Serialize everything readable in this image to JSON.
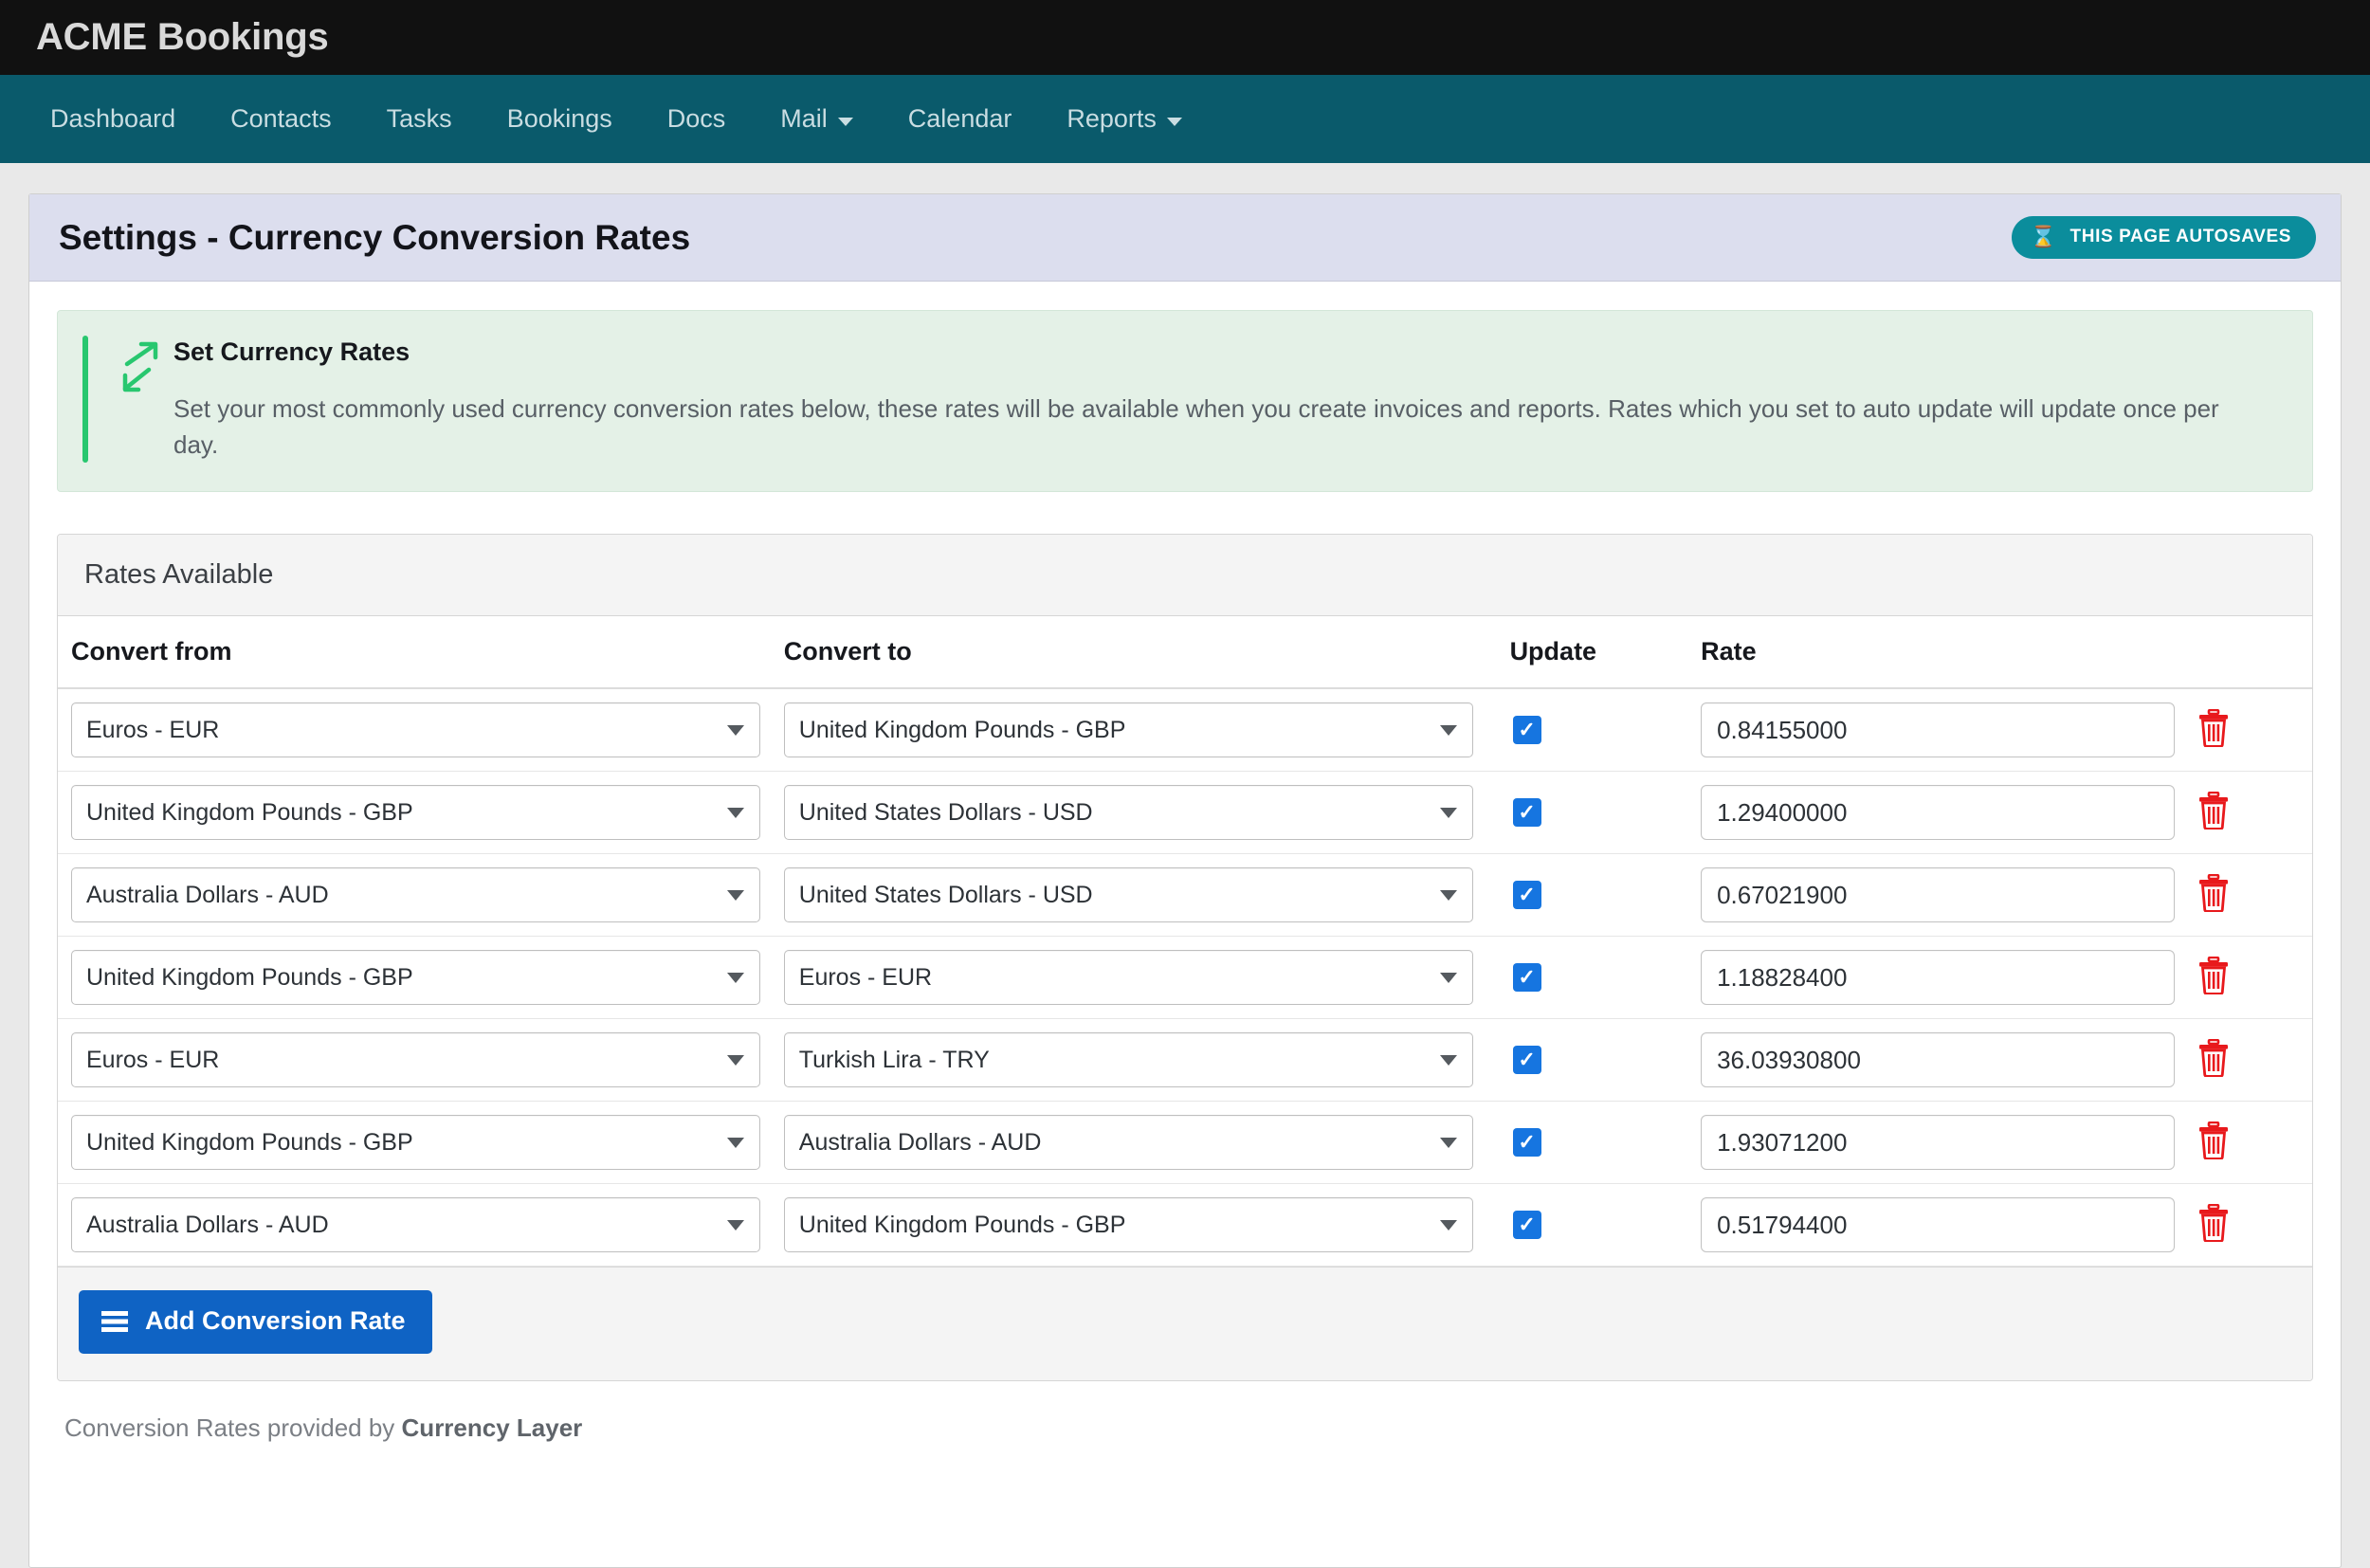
{
  "brand": {
    "title": "ACME Bookings"
  },
  "nav": {
    "items": [
      {
        "label": "Dashboard",
        "has_caret": false
      },
      {
        "label": "Contacts",
        "has_caret": false
      },
      {
        "label": "Tasks",
        "has_caret": false
      },
      {
        "label": "Bookings",
        "has_caret": false
      },
      {
        "label": "Docs",
        "has_caret": false
      },
      {
        "label": "Mail",
        "has_caret": true
      },
      {
        "label": "Calendar",
        "has_caret": false
      },
      {
        "label": "Reports",
        "has_caret": true
      }
    ]
  },
  "page": {
    "title": "Settings - Currency Conversion Rates",
    "autosave_badge": "THIS PAGE AUTOSAVES",
    "autosave_icon": "hourglass-icon"
  },
  "callout": {
    "icon": "expand-diagonal-arrows-icon",
    "title": "Set Currency Rates",
    "description": "Set your most commonly used currency conversion rates below, these rates will be available when you create invoices and reports. Rates which you set to auto update will update once per day."
  },
  "panel": {
    "heading": "Rates Available",
    "columns": {
      "from": "Convert from",
      "to": "Convert to",
      "update": "Update",
      "rate": "Rate",
      "delete": ""
    },
    "rows": [
      {
        "from": "Euros - EUR",
        "to": "United Kingdom Pounds - GBP",
        "update": true,
        "rate": "0.84155000",
        "delete_icon": "trash-icon"
      },
      {
        "from": "United Kingdom Pounds - GBP",
        "to": "United States Dollars - USD",
        "update": true,
        "rate": "1.29400000",
        "delete_icon": "trash-icon"
      },
      {
        "from": "Australia Dollars - AUD",
        "to": "United States Dollars - USD",
        "update": true,
        "rate": "0.67021900",
        "delete_icon": "trash-icon"
      },
      {
        "from": "United Kingdom Pounds - GBP",
        "to": "Euros - EUR",
        "update": true,
        "rate": "1.18828400",
        "delete_icon": "trash-icon"
      },
      {
        "from": "Euros - EUR",
        "to": "Turkish Lira - TRY",
        "update": true,
        "rate": "36.03930800",
        "delete_icon": "trash-icon"
      },
      {
        "from": "United Kingdom Pounds - GBP",
        "to": "Australia Dollars - AUD",
        "update": true,
        "rate": "1.93071200",
        "delete_icon": "trash-icon"
      },
      {
        "from": "Australia Dollars - AUD",
        "to": "United Kingdom Pounds - GBP",
        "update": true,
        "rate": "0.51794400",
        "delete_icon": "trash-icon"
      }
    ],
    "add_button": {
      "label": "Add Conversion Rate",
      "icon": "list-lines-icon"
    }
  },
  "credit": {
    "prefix": "Conversion Rates provided by ",
    "provider": "Currency Layer"
  },
  "colors": {
    "brandbar_bg": "#111111",
    "navbar_bg": "#0a5a6b",
    "page_header_bg": "#dcdeee",
    "autosave_badge_bg": "#0b8d9c",
    "callout_bg": "#e4f1e7",
    "callout_accent": "#28c76f",
    "checkbox_blue": "#1675e0",
    "add_button_blue": "#0f63c4",
    "trash_red": "#e8191c"
  }
}
